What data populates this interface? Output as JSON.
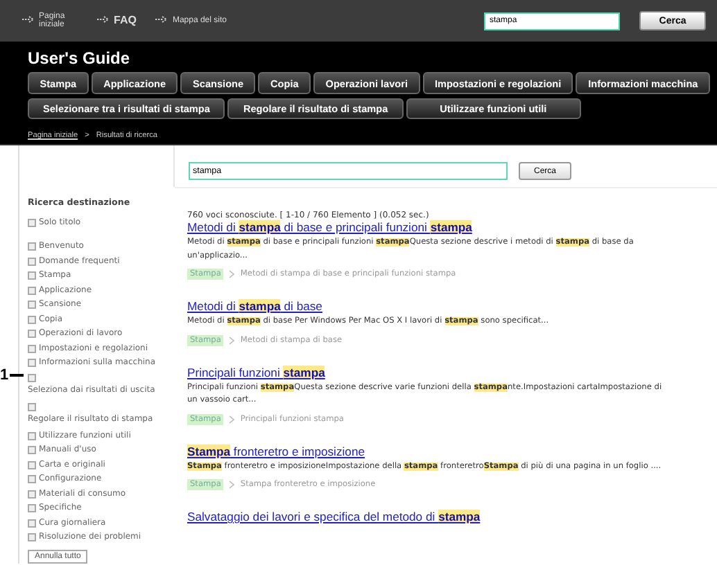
{
  "top_links": [
    {
      "label": "Pagina iniziale"
    },
    {
      "label": "FAQ"
    },
    {
      "label": "Mappa del sito"
    }
  ],
  "top_search": {
    "value": "stampa",
    "button": "Cerca"
  },
  "header": {
    "title": "User's Guide"
  },
  "nav_primary": [
    "Stampa",
    "Applicazione",
    "Scansione",
    "Copia",
    "Operazioni lavori",
    "Impostazioni e regolazioni",
    "Informazioni macchina"
  ],
  "nav_secondary": [
    "Selezionare tra i risultati di stampa",
    "Regolare il risultato di stampa",
    "Utilizzare funzioni utili"
  ],
  "breadcrumb": {
    "link": "Pagina iniziale",
    "separator": ">",
    "current": "Risultati di ricerca"
  },
  "search": {
    "value": "stampa",
    "button": "Cerca"
  },
  "sidebar": {
    "title": "Ricerca destinazione",
    "options": [
      {
        "label": "Solo titolo",
        "checked": false
      }
    ],
    "items": [
      {
        "label": "Benvenuto",
        "checked": false,
        "kind": "inline"
      },
      {
        "label": "Domande frequenti",
        "checked": false,
        "kind": "inline"
      },
      {
        "label": "Stampa",
        "checked": false,
        "kind": "inline"
      },
      {
        "label": "Applicazione",
        "checked": false,
        "kind": "inline"
      },
      {
        "label": "Scansione",
        "checked": false,
        "kind": "inline"
      },
      {
        "label": "Copia",
        "checked": false,
        "kind": "inline"
      },
      {
        "label": "Operazioni di lavoro",
        "checked": false,
        "kind": "inline"
      },
      {
        "label": "Impostazioni e regolazioni",
        "checked": false,
        "kind": "inline"
      },
      {
        "label": "Informazioni sulla macchina",
        "checked": false,
        "kind": "inline"
      },
      {
        "label": "Seleziona dai risultati di uscita",
        "checked": false,
        "kind": "stacked"
      },
      {
        "label": "Regolare il risultato di stampa",
        "checked": false,
        "kind": "stacked"
      },
      {
        "label": "Utilizzare funzioni utili",
        "checked": false,
        "kind": "inline"
      },
      {
        "label": "Manuali d'uso",
        "checked": false,
        "kind": "inline"
      },
      {
        "label": "Carta e originali",
        "checked": false,
        "kind": "inline"
      },
      {
        "label": "Configurazione",
        "checked": false,
        "kind": "inline"
      },
      {
        "label": "Materiali di consumo",
        "checked": false,
        "kind": "inline"
      },
      {
        "label": "Specifiche",
        "checked": false,
        "kind": "inline"
      },
      {
        "label": "Cura giornaliera",
        "checked": false,
        "kind": "inline"
      },
      {
        "label": "Risoluzione dei problemi",
        "checked": false,
        "kind": "inline"
      }
    ],
    "button": "Annulla tutto"
  },
  "callout": {
    "label": "1"
  },
  "results": {
    "summary": "760 voci sconosciute. [ 1-10 / 760 Elemento ] (0.052 sec.)",
    "items": [
      {
        "title": "Metodi di **stampa** di base e principali funzioni **stampa**",
        "snippet": "Metodi di **stampa** di base e principali funzioni **stampa**Questa sezione descrive i metodi di **stampa** di base da un'applicazio...",
        "category": "Stampa",
        "path": "Metodi di stampa di base e principali funzioni stampa"
      },
      {
        "title": "Metodi di **stampa** di base",
        "snippet": "Metodi di **stampa** di base Per Windows Per Mac OS X I lavori di **stampa** sono specificat...",
        "category": "Stampa",
        "path": "Metodi di stampa di base"
      },
      {
        "title": "Principali funzioni **stampa**",
        "snippet": "Principali funzioni **stampa**Questa sezione descrive varie funzioni della **stampa**nte.Impostazioni cartaImpostazione di un vassoio cart...",
        "category": "Stampa",
        "path": "Principali funzioni stampa"
      },
      {
        "title": "**Stampa** fronteretro e imposizione",
        "snippet": "**Stampa** fronteretro e imposizioneImpostazione della **stampa** fronteretro**Stampa** di più di una pagina in un foglio ....",
        "category": "Stampa",
        "path": "Stampa fronteretro e imposizione"
      },
      {
        "title": "Salvataggio dei lavori e specifica del metodo di **stampa**"
      }
    ]
  }
}
